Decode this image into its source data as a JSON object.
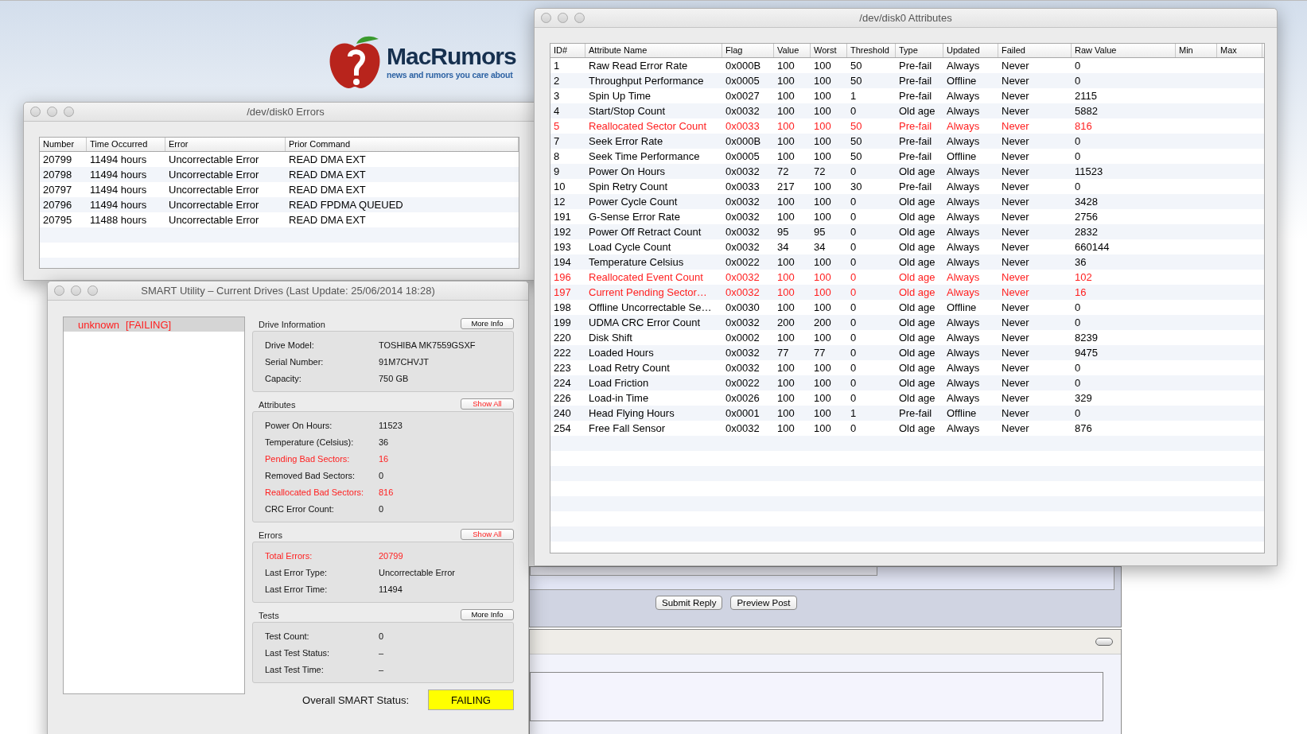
{
  "logo": {
    "name": "MacRumors",
    "tagline": "news and rumors you care about"
  },
  "errors_window": {
    "title": "/dev/disk0 Errors",
    "columns": [
      "Number",
      "Time Occurred",
      "Error",
      "Prior Command"
    ],
    "rows": [
      [
        "20799",
        "11494 hours",
        "Uncorrectable Error",
        "READ DMA EXT"
      ],
      [
        "20798",
        "11494 hours",
        "Uncorrectable Error",
        "READ DMA EXT"
      ],
      [
        "20797",
        "11494 hours",
        "Uncorrectable Error",
        "READ DMA EXT"
      ],
      [
        "20796",
        "11494 hours",
        "Uncorrectable Error",
        "READ FPDMA QUEUED"
      ],
      [
        "20795",
        "11488 hours",
        "Uncorrectable Error",
        "READ DMA EXT"
      ]
    ]
  },
  "attributes_window": {
    "title": "/dev/disk0 Attributes",
    "columns": [
      "ID#",
      "Attribute Name",
      "Flag",
      "Value",
      "Worst",
      "Threshold",
      "Type",
      "Updated",
      "Failed",
      "Raw Value",
      "Min",
      "Max"
    ],
    "rows": [
      {
        "alert": false,
        "cells": [
          "1",
          "Raw Read Error Rate",
          "0x000B",
          "100",
          "100",
          "50",
          "Pre-fail",
          "Always",
          "Never",
          "0"
        ]
      },
      {
        "alert": false,
        "cells": [
          "2",
          "Throughput Performance",
          "0x0005",
          "100",
          "100",
          "50",
          "Pre-fail",
          "Offline",
          "Never",
          "0"
        ]
      },
      {
        "alert": false,
        "cells": [
          "3",
          "Spin Up Time",
          "0x0027",
          "100",
          "100",
          "1",
          "Pre-fail",
          "Always",
          "Never",
          "2115"
        ]
      },
      {
        "alert": false,
        "cells": [
          "4",
          "Start/Stop Count",
          "0x0032",
          "100",
          "100",
          "0",
          "Old age",
          "Always",
          "Never",
          "5882"
        ]
      },
      {
        "alert": true,
        "cells": [
          "5",
          "Reallocated Sector Count",
          "0x0033",
          "100",
          "100",
          "50",
          "Pre-fail",
          "Always",
          "Never",
          "816"
        ]
      },
      {
        "alert": false,
        "cells": [
          "7",
          "Seek Error Rate",
          "0x000B",
          "100",
          "100",
          "50",
          "Pre-fail",
          "Always",
          "Never",
          "0"
        ]
      },
      {
        "alert": false,
        "cells": [
          "8",
          "Seek Time Performance",
          "0x0005",
          "100",
          "100",
          "50",
          "Pre-fail",
          "Offline",
          "Never",
          "0"
        ]
      },
      {
        "alert": false,
        "cells": [
          "9",
          "Power On Hours",
          "0x0032",
          "72",
          "72",
          "0",
          "Old age",
          "Always",
          "Never",
          "11523"
        ]
      },
      {
        "alert": false,
        "cells": [
          "10",
          "Spin Retry Count",
          "0x0033",
          "217",
          "100",
          "30",
          "Pre-fail",
          "Always",
          "Never",
          "0"
        ]
      },
      {
        "alert": false,
        "cells": [
          "12",
          "Power Cycle Count",
          "0x0032",
          "100",
          "100",
          "0",
          "Old age",
          "Always",
          "Never",
          "3428"
        ]
      },
      {
        "alert": false,
        "cells": [
          "191",
          "G-Sense Error Rate",
          "0x0032",
          "100",
          "100",
          "0",
          "Old age",
          "Always",
          "Never",
          "2756"
        ]
      },
      {
        "alert": false,
        "cells": [
          "192",
          "Power Off Retract Count",
          "0x0032",
          "95",
          "95",
          "0",
          "Old age",
          "Always",
          "Never",
          "2832"
        ]
      },
      {
        "alert": false,
        "cells": [
          "193",
          "Load Cycle Count",
          "0x0032",
          "34",
          "34",
          "0",
          "Old age",
          "Always",
          "Never",
          "660144"
        ]
      },
      {
        "alert": false,
        "cells": [
          "194",
          "Temperature Celsius",
          "0x0022",
          "100",
          "100",
          "0",
          "Old age",
          "Always",
          "Never",
          "36"
        ]
      },
      {
        "alert": true,
        "cells": [
          "196",
          "Reallocated Event Count",
          "0x0032",
          "100",
          "100",
          "0",
          "Old age",
          "Always",
          "Never",
          "102"
        ]
      },
      {
        "alert": true,
        "cells": [
          "197",
          "Current Pending Sector…",
          "0x0032",
          "100",
          "100",
          "0",
          "Old age",
          "Always",
          "Never",
          "16"
        ]
      },
      {
        "alert": false,
        "cells": [
          "198",
          "Offline Uncorrectable Se…",
          "0x0030",
          "100",
          "100",
          "0",
          "Old age",
          "Offline",
          "Never",
          "0"
        ]
      },
      {
        "alert": false,
        "cells": [
          "199",
          "UDMA CRC Error Count",
          "0x0032",
          "200",
          "200",
          "0",
          "Old age",
          "Always",
          "Never",
          "0"
        ]
      },
      {
        "alert": false,
        "cells": [
          "220",
          "Disk Shift",
          "0x0002",
          "100",
          "100",
          "0",
          "Old age",
          "Always",
          "Never",
          "8239"
        ]
      },
      {
        "alert": false,
        "cells": [
          "222",
          "Loaded Hours",
          "0x0032",
          "77",
          "77",
          "0",
          "Old age",
          "Always",
          "Never",
          "9475"
        ]
      },
      {
        "alert": false,
        "cells": [
          "223",
          "Load Retry Count",
          "0x0032",
          "100",
          "100",
          "0",
          "Old age",
          "Always",
          "Never",
          "0"
        ]
      },
      {
        "alert": false,
        "cells": [
          "224",
          "Load Friction",
          "0x0022",
          "100",
          "100",
          "0",
          "Old age",
          "Always",
          "Never",
          "0"
        ]
      },
      {
        "alert": false,
        "cells": [
          "226",
          "Load-in Time",
          "0x0026",
          "100",
          "100",
          "0",
          "Old age",
          "Always",
          "Never",
          "329"
        ]
      },
      {
        "alert": false,
        "cells": [
          "240",
          "Head Flying Hours",
          "0x0001",
          "100",
          "100",
          "1",
          "Pre-fail",
          "Offline",
          "Never",
          "0"
        ]
      },
      {
        "alert": false,
        "cells": [
          "254",
          "Free Fall Sensor",
          "0x0032",
          "100",
          "100",
          "0",
          "Old age",
          "Always",
          "Never",
          "876"
        ]
      }
    ]
  },
  "smart_window": {
    "title": "SMART Utility – Current Drives (Last Update: 25/06/2014 18:28)",
    "drives": [
      {
        "name": "unknown",
        "status": "[FAILING]",
        "selected": true,
        "alert": true
      }
    ],
    "sections": [
      {
        "title": "Drive Information",
        "button": {
          "label": "More Info",
          "alert": false
        },
        "rows": [
          {
            "label": "Drive Model:",
            "value": "TOSHIBA MK7559GSXF",
            "alert": false
          },
          {
            "label": "Serial Number:",
            "value": "91M7CHVJT",
            "alert": false
          },
          {
            "label": "Capacity:",
            "value": "750 GB",
            "alert": false
          }
        ]
      },
      {
        "title": "Attributes",
        "button": {
          "label": "Show All",
          "alert": true
        },
        "rows": [
          {
            "label": "Power On Hours:",
            "value": "11523",
            "alert": false
          },
          {
            "label": "Temperature (Celsius):",
            "value": "36",
            "alert": false
          },
          {
            "label": "Pending Bad Sectors:",
            "value": "16",
            "alert": true
          },
          {
            "label": "Removed Bad Sectors:",
            "value": "0",
            "alert": false
          },
          {
            "label": "Reallocated Bad Sectors:",
            "value": "816",
            "alert": true
          },
          {
            "label": "CRC Error Count:",
            "value": "0",
            "alert": false
          }
        ]
      },
      {
        "title": "Errors",
        "button": {
          "label": "Show All",
          "alert": true
        },
        "rows": [
          {
            "label": "Total Errors:",
            "value": "20799",
            "alert": true
          },
          {
            "label": "Last Error Type:",
            "value": "Uncorrectable Error",
            "alert": false
          },
          {
            "label": "Last Error Time:",
            "value": "11494",
            "alert": false
          }
        ]
      },
      {
        "title": "Tests",
        "button": {
          "label": "More Info",
          "alert": false
        },
        "rows": [
          {
            "label": "Test Count:",
            "value": "0",
            "alert": false
          },
          {
            "label": "Last Test Status:",
            "value": "–",
            "alert": false
          },
          {
            "label": "Last Test Time:",
            "value": "–",
            "alert": false
          }
        ]
      }
    ],
    "overall": {
      "label": "Overall SMART Status:",
      "value": "FAILING",
      "kind": "failing"
    }
  },
  "forum": {
    "buttons": [
      "Submit Reply",
      "Preview Post"
    ]
  }
}
